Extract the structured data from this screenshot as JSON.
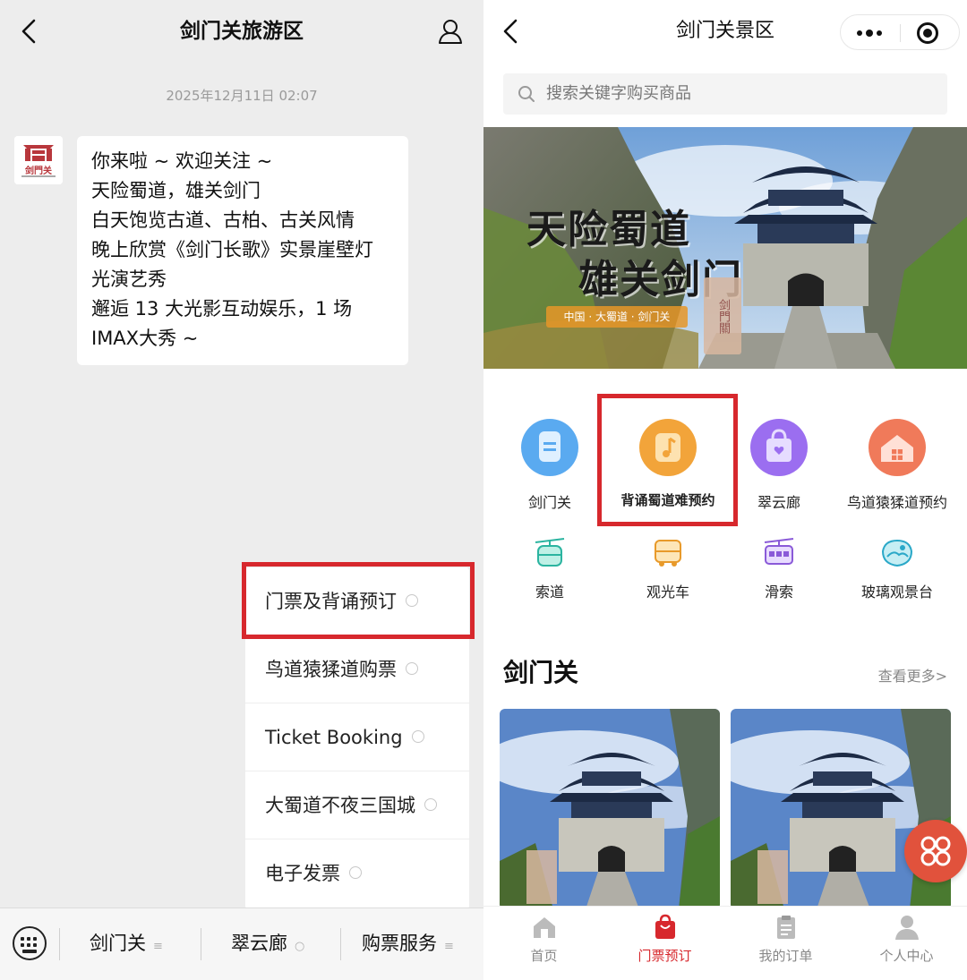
{
  "left": {
    "title": "剑门关旅游区",
    "timestamp": "2025年12月11日 02:07",
    "message_lines": [
      "你来啦 ~ 欢迎关注 ~",
      "天险蜀道，雄关剑门",
      "白天饱览古道、古柏、古关风情",
      "晚上欣赏《剑门长歌》实景崖壁灯",
      "光演艺秀",
      "邂逅 13 大光影互动娱乐，1 场",
      "IMAX大秀 ~"
    ],
    "avatar_logo": "剑門关",
    "menu_items": [
      "门票及背诵预订",
      "鸟道猿猱道购票",
      "Ticket Booking",
      "大蜀道不夜三国城",
      "电子发票"
    ],
    "bottom_tabs": [
      "剑门关",
      "翠云廊",
      "购票服务"
    ]
  },
  "right": {
    "title": "剑门关景区",
    "search_placeholder": "搜索关键字购买商品",
    "banner": {
      "line1": "天险蜀道",
      "line2": "雄关剑门",
      "subtitle": "中国 · 大蜀道 · 剑门关",
      "seal": "剑門關"
    },
    "grid_row1": [
      {
        "label": "剑门关",
        "icon": "document-icon",
        "color": "#5aaaf0"
      },
      {
        "label": "背诵蜀道难预约",
        "icon": "music-icon",
        "color": "#f2a43a"
      },
      {
        "label": "翠云廊",
        "icon": "shopping-bag-icon",
        "color": "#9b6ef0"
      },
      {
        "label": "鸟道猿猱道预约",
        "icon": "house-icon",
        "color": "#f07a5a"
      }
    ],
    "grid_row2": [
      {
        "label": "索道",
        "icon": "cable-car-icon"
      },
      {
        "label": "观光车",
        "icon": "sightseeing-bus-icon"
      },
      {
        "label": "滑索",
        "icon": "zipline-icon"
      },
      {
        "label": "玻璃观景台",
        "icon": "glass-platform-icon"
      }
    ],
    "section_title": "剑门关",
    "section_more": "查看更多>",
    "tabbar": [
      {
        "label": "首页",
        "active": false
      },
      {
        "label": "门票预订",
        "active": true
      },
      {
        "label": "我的订单",
        "active": false
      },
      {
        "label": "个人中心",
        "active": false
      }
    ],
    "accent_color": "#d7282d"
  }
}
